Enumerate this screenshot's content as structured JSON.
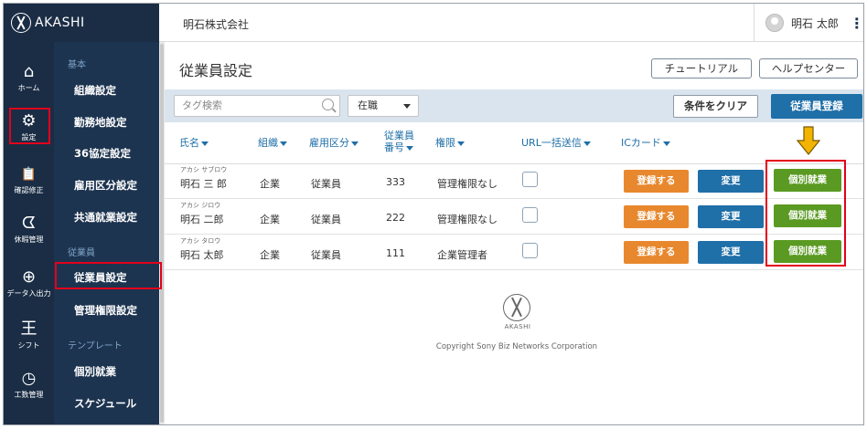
{
  "app": {
    "brand": "AKASHI"
  },
  "header": {
    "company": "明石株式会社",
    "user_name": "明石 太郎"
  },
  "rail": [
    {
      "label": "ホーム",
      "icon": "home-icon",
      "glyph": "⌂"
    },
    {
      "label": "設定",
      "icon": "gear-icon",
      "glyph": "⚙"
    },
    {
      "label": "確認修正",
      "icon": "clipboard-check-icon",
      "glyph": "📋"
    },
    {
      "label": "休暇管理",
      "icon": "vacation-icon",
      "glyph": "ᗧ"
    },
    {
      "label": "データ入出力",
      "icon": "download-icon",
      "glyph": "⊕"
    },
    {
      "label": "シフト",
      "icon": "shift-icon",
      "glyph": "王"
    },
    {
      "label": "工数管理",
      "icon": "clock-icon",
      "glyph": "◷"
    }
  ],
  "submenu": {
    "heading_basic": "基本",
    "items_basic": [
      "組織設定",
      "勤務地設定",
      "36協定設定",
      "雇用区分設定",
      "共通就業設定"
    ],
    "heading_employee": "従業員",
    "items_employee": [
      "従業員設定",
      "管理権限設定"
    ],
    "heading_template": "テンプレート",
    "items_template": [
      "個別就業",
      "スケジュール"
    ]
  },
  "main": {
    "title": "従業員設定",
    "tutorial_label": "チュートリアル",
    "help_label": "ヘルプセンター",
    "tag_search_placeholder": "タグ検索",
    "status_value": "在職",
    "clear_label": "条件をクリア",
    "register_label": "従業員登録"
  },
  "table": {
    "headers": {
      "name": "氏名",
      "org": "組織",
      "employment": "雇用区分",
      "number_line1": "従業員",
      "number_line2": "番号",
      "authority": "権限",
      "url_send": "URL一括送信",
      "ic_card": "ICカード"
    },
    "rows": [
      {
        "kana": "アカシ サブロウ",
        "name": "明石 三 郎",
        "org": "企業",
        "employment": "従業員",
        "number": "333",
        "authority": "管理権限なし",
        "checked": false
      },
      {
        "kana": "アカシ ジロウ",
        "name": "明石 二郎",
        "org": "企業",
        "employment": "従業員",
        "number": "222",
        "authority": "管理権限なし",
        "checked": false
      },
      {
        "kana": "アカシ タロウ",
        "name": "明石 太郎",
        "org": "企業",
        "employment": "従業員",
        "number": "111",
        "authority": "企業管理者",
        "checked": false
      }
    ],
    "btn_register_ic": "登録する",
    "btn_change": "変更",
    "btn_individual": "個別就業"
  },
  "footer": {
    "brand": "AKASHI",
    "copyright": "Copyright Sony Biz Networks Corporation"
  },
  "colors": {
    "nav_dark": "#1a2d45",
    "accent_blue": "#1f6fa8",
    "orange": "#e8882e",
    "green": "#5a9a22",
    "highlight_red": "#e3001b",
    "arrow_yellow": "#f2b400"
  }
}
